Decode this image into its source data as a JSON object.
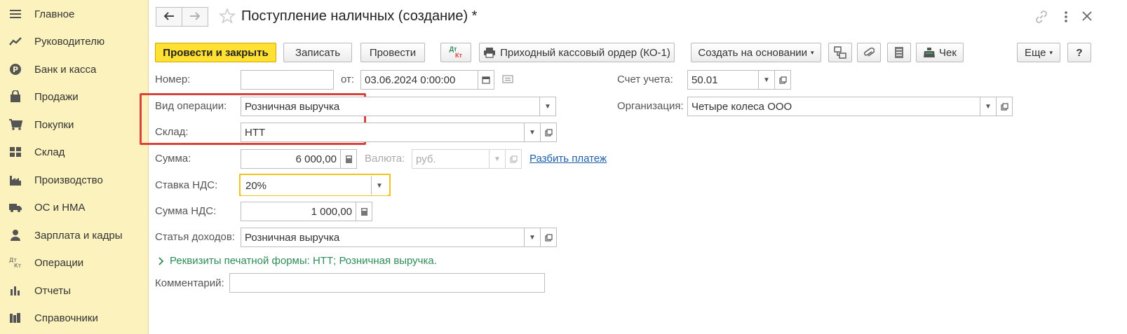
{
  "sidebar": {
    "items": [
      {
        "label": "Главное",
        "icon": "menu-lines-icon"
      },
      {
        "label": "Руководителю",
        "icon": "trend-chart-icon"
      },
      {
        "label": "Банк и касса",
        "icon": "ruble-coin-icon"
      },
      {
        "label": "Продажи",
        "icon": "shopping-bag-icon"
      },
      {
        "label": "Покупки",
        "icon": "cart-icon"
      },
      {
        "label": "Склад",
        "icon": "warehouse-grid-icon"
      },
      {
        "label": "Производство",
        "icon": "factory-icon"
      },
      {
        "label": "ОС и НМА",
        "icon": "truck-icon"
      },
      {
        "label": "Зарплата и кадры",
        "icon": "person-icon"
      },
      {
        "label": "Операции",
        "icon": "dt-kt-icon"
      },
      {
        "label": "Отчеты",
        "icon": "bar-chart-icon"
      },
      {
        "label": "Справочники",
        "icon": "books-icon"
      }
    ]
  },
  "header": {
    "title": "Поступление наличных (создание) *",
    "back_glyph": "🡐",
    "forward_glyph": "🡒"
  },
  "toolbar": {
    "post_close": "Провести и закрыть",
    "save": "Записать",
    "post": "Провести",
    "dtkt_top": "Дт",
    "dtkt_bottom": "Кт",
    "print_order": "Приходный кассовый ордер (КО-1)",
    "create_based": "Создать на основании",
    "receipt": "Чек",
    "more": "Еще",
    "help": "?"
  },
  "form": {
    "number_label": "Номер:",
    "number_value": "",
    "date_label": "от:",
    "date_value": "03.06.2024  0:00:00",
    "account_label": "Счет учета:",
    "account_value": "50.01",
    "operation_label": "Вид операции:",
    "operation_value": "Розничная выручка",
    "org_label": "Организация:",
    "org_value": "Четыре колеса ООО",
    "warehouse_label": "Склад:",
    "warehouse_value": "НТТ",
    "sum_label": "Сумма:",
    "sum_value": "6 000,00",
    "currency_label": "Валюта:",
    "currency_value": "руб.",
    "split_payment": "Разбить платеж",
    "vat_rate_label": "Ставка НДС:",
    "vat_rate_value": "20%",
    "vat_sum_label": "Сумма НДС:",
    "vat_sum_value": "1 000,00",
    "income_item_label": "Статья доходов:",
    "income_item_value": "Розничная выручка",
    "print_details": "Реквизиты печатной формы: НТТ; Розничная выручка.",
    "comment_label": "Комментарий:",
    "comment_value": ""
  },
  "colors": {
    "sidebar_bg": "#fbf2bd",
    "primary_button": "#ffe033",
    "highlight_box": "#d9443a",
    "focus_border": "#f0c419",
    "link": "#1e5fa8",
    "group_header": "#2e8b57"
  }
}
